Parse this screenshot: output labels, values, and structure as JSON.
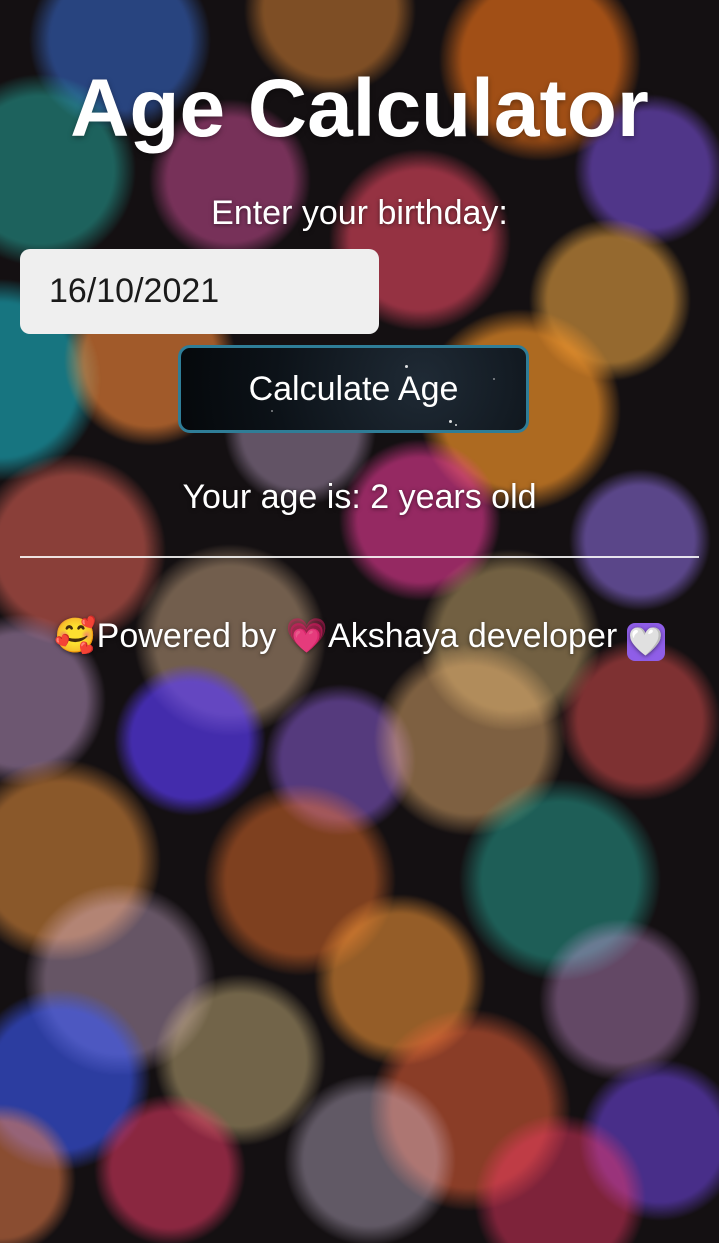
{
  "app": {
    "title": "Age Calculator"
  },
  "form": {
    "prompt": "Enter your birthday:",
    "birthday_value": "16/10/2021",
    "calculate_label": "Calculate Age"
  },
  "result": {
    "text": "Your age is: 2 years old"
  },
  "footer": {
    "emoji_face": "🥰",
    "powered_text": "Powered by",
    "emoji_heart": "💗",
    "developer_text": "Akshaya developer",
    "emoji_white_heart": "🤍"
  },
  "icons": {
    "face": "smiling-face-with-hearts-icon",
    "heart": "growing-heart-icon",
    "white_heart": "white-heart-icon"
  },
  "colors": {
    "button_border": "#2f7d97",
    "input_background": "#efefef",
    "text": "#ffffff"
  }
}
